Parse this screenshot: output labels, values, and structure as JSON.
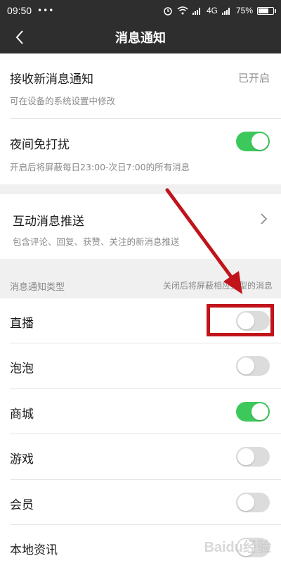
{
  "status_bar": {
    "time": "09:50",
    "dots": "•••",
    "network": "4G",
    "battery": "75%",
    "battery_level": 0.75
  },
  "nav": {
    "title": "消息通知",
    "back_icon": "chevron-left-icon"
  },
  "receive_notifications": {
    "title": "接收新消息通知",
    "value": "已开启",
    "subtitle": "可在设备的系统设置中修改"
  },
  "night_mode": {
    "title": "夜间免打扰",
    "subtitle": "开启后将屏蔽每日23:00-次日7:00的所有消息",
    "enabled": true
  },
  "interaction_push": {
    "title": "互动消息推送",
    "subtitle": "包含评论、回复、获赞、关注的新消息推送",
    "icon": "chevron-right-icon"
  },
  "types_section": {
    "header_left": "消息通知类型",
    "header_right": "关闭后将屏蔽相应类型的消息"
  },
  "types": [
    {
      "label": "直播",
      "enabled": false
    },
    {
      "label": "泡泡",
      "enabled": false
    },
    {
      "label": "商城",
      "enabled": true
    },
    {
      "label": "游戏",
      "enabled": false
    },
    {
      "label": "会员",
      "enabled": false
    },
    {
      "label": "本地资讯",
      "enabled": false
    }
  ],
  "annotation": {
    "color": "#c0141a"
  },
  "watermark": {
    "text": "Baidu经验"
  },
  "colors": {
    "toggle_on": "#3cc85a",
    "toggle_off": "#dcdcdc",
    "nav_bg": "#2e2e2e"
  }
}
